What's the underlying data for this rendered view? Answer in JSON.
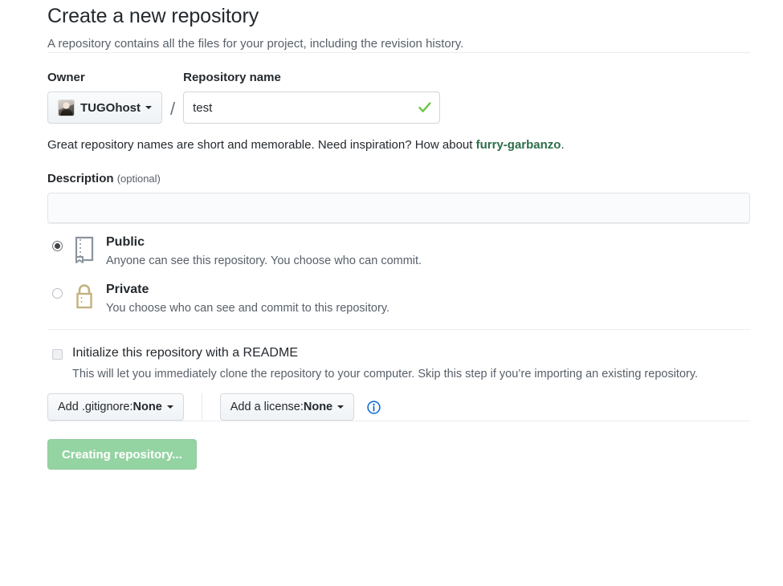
{
  "header": {
    "title": "Create a new repository",
    "subtitle": "A repository contains all the files for your project, including the revision history."
  },
  "owner": {
    "label": "Owner",
    "name": "TUGOhost",
    "avatar_icon": "user-avatar-image"
  },
  "repository_name": {
    "label": "Repository name",
    "value": "test",
    "placeholder": "",
    "valid_icon": "green-check-icon"
  },
  "name_hint": {
    "prefix": "Great repository names are short and memorable. Need inspiration? How about ",
    "suggestion": "furry-garbanzo",
    "suffix": "."
  },
  "description": {
    "label": "Description",
    "optional_label": "(optional)",
    "value": "",
    "placeholder": ""
  },
  "visibility": {
    "options": [
      {
        "title": "Public",
        "description": "Anyone can see this repository. You choose who can commit.",
        "icon": "repo-book-icon",
        "selected": true
      },
      {
        "title": "Private",
        "description": "You choose who can see and commit to this repository.",
        "icon": "lock-icon",
        "selected": false
      }
    ]
  },
  "readme": {
    "label": "Initialize this repository with a README",
    "description": "This will let you immediately clone the repository to your computer. Skip this step if you’re importing an existing repository.",
    "checked": false
  },
  "options": {
    "gitignore_prefix": "Add .gitignore: ",
    "gitignore_value": "None",
    "license_prefix": "Add a license: ",
    "license_value": "None",
    "info_icon": "info-circle-icon"
  },
  "submit": {
    "label": "Creating repository...",
    "disabled": true
  },
  "colors": {
    "accent_green": "#2c6e49",
    "check_green": "#6cc644",
    "button_green": "#94d3a2",
    "lock_gold": "#c2b280",
    "repo_gray": "#6a737d",
    "info_blue": "#0366d6",
    "rule": "#eaecef"
  }
}
